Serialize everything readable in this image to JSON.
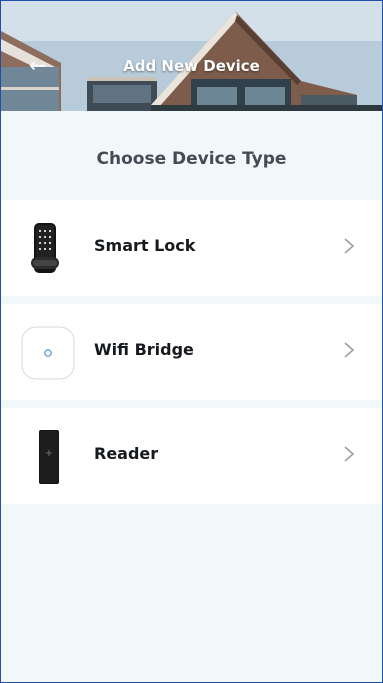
{
  "header": {
    "title": "Add New Device",
    "back_icon": "back-arrow-icon"
  },
  "section": {
    "title": "Choose Device Type"
  },
  "devices": [
    {
      "label": "Smart Lock",
      "icon": "smart-lock-icon"
    },
    {
      "label": "Wifi Bridge",
      "icon": "wifi-bridge-icon"
    },
    {
      "label": "Reader",
      "icon": "reader-icon"
    }
  ],
  "colors": {
    "background": "#f2f8fa",
    "row_background": "#ffffff",
    "title_text": "#454b53",
    "label_text": "#16191d",
    "chevron": "#9aa0a6"
  }
}
